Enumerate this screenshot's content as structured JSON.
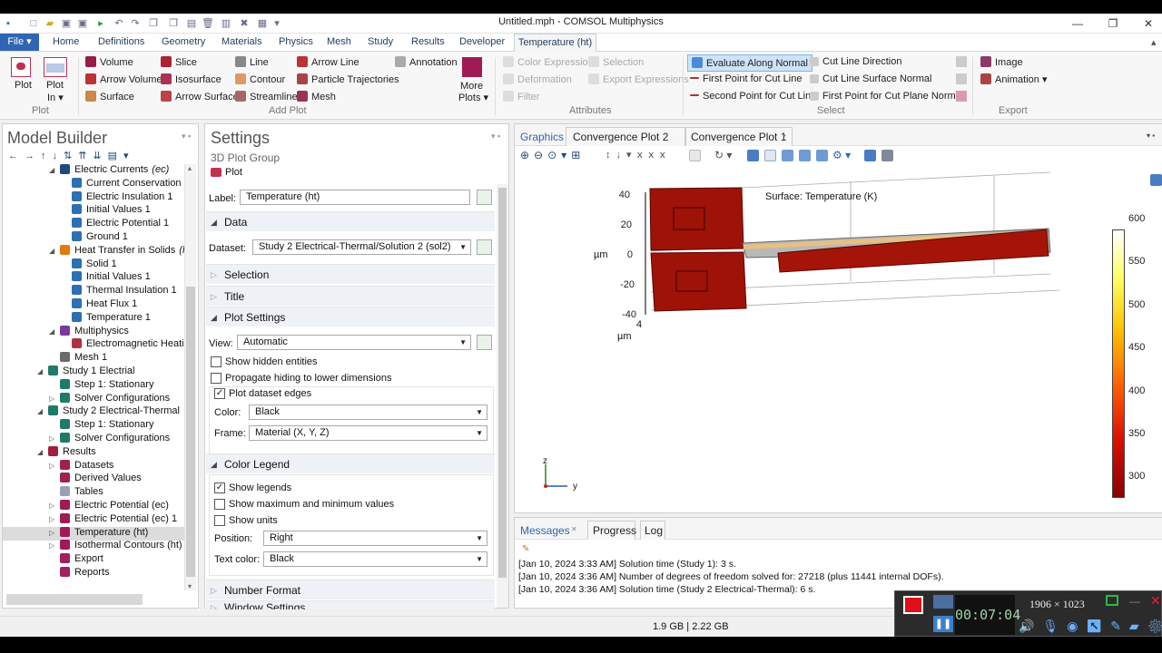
{
  "window": {
    "title": "Untitled.mph - COMSOL Multiphysics"
  },
  "menu_tabs": [
    "Home",
    "Definitions",
    "Geometry",
    "Materials",
    "Physics",
    "Mesh",
    "Study",
    "Results",
    "Developer"
  ],
  "file_label": "File ▾",
  "active_tab": "Temperature (ht)",
  "ribbon": {
    "plot": {
      "plot": "Plot",
      "plot_in": "Plot",
      "plot_in2": "In ▾",
      "group": "Plot"
    },
    "add_plot": {
      "items": [
        "Volume",
        "Arrow Volume",
        "Surface",
        "Slice",
        "Isosurface",
        "Arrow Surface",
        "Line",
        "Contour",
        "Streamline",
        "Arrow Line",
        "Particle Trajectories",
        "Mesh",
        "Annotation"
      ],
      "more": "More",
      "more2": "Plots ▾",
      "group": "Add Plot"
    },
    "attributes": {
      "items": [
        "Color Expression",
        "Selection",
        "Deformation",
        "Export Expressions",
        "Filter"
      ],
      "group": "Attributes"
    },
    "select": {
      "items": [
        "Evaluate Along Normal",
        "First Point for Cut Line",
        "Second Point for Cut Line",
        "Cut Line Direction",
        "Cut Line Surface Normal",
        "First Point for Cut Plane Normal"
      ],
      "group": "Select"
    },
    "export": {
      "items": [
        "Image",
        "Animation ▾"
      ],
      "group": "Export"
    }
  },
  "model_builder": {
    "title": "Model Builder",
    "tree": [
      {
        "label": "Electric Currents",
        "tag": "(ec)"
      },
      {
        "label": "Current Conservation 1"
      },
      {
        "label": "Electric Insulation 1"
      },
      {
        "label": "Initial Values 1"
      },
      {
        "label": "Electric Potential 1"
      },
      {
        "label": "Ground 1"
      },
      {
        "label": "Heat Transfer in Solids",
        "tag": "(ht)"
      },
      {
        "label": "Solid 1"
      },
      {
        "label": "Initial Values 1"
      },
      {
        "label": "Thermal Insulation 1"
      },
      {
        "label": "Heat Flux 1"
      },
      {
        "label": "Temperature 1"
      },
      {
        "label": "Multiphysics"
      },
      {
        "label": "Electromagnetic Heating"
      },
      {
        "label": "Mesh 1"
      },
      {
        "label": "Study 1 Electrial"
      },
      {
        "label": "Step 1: Stationary"
      },
      {
        "label": "Solver Configurations"
      },
      {
        "label": "Study 2 Electrical-Thermal"
      },
      {
        "label": "Step 1: Stationary"
      },
      {
        "label": "Solver Configurations"
      },
      {
        "label": "Results"
      },
      {
        "label": "Datasets"
      },
      {
        "label": "Derived Values"
      },
      {
        "label": "Tables"
      },
      {
        "label": "Electric Potential (ec)"
      },
      {
        "label": "Electric Potential (ec) 1"
      },
      {
        "label": "Temperature (ht)"
      },
      {
        "label": "Isothermal Contours (ht)"
      },
      {
        "label": "Export"
      },
      {
        "label": "Reports"
      }
    ]
  },
  "settings": {
    "title": "Settings",
    "subtitle": "3D Plot Group",
    "plot_btn": "Plot",
    "label_caption": "Label:",
    "label_value": "Temperature (ht)",
    "sections": {
      "data": "Data",
      "selection": "Selection",
      "title": "Title",
      "plot_settings": "Plot Settings",
      "color_legend": "Color Legend",
      "number_format": "Number Format",
      "window_settings": "Window Settings"
    },
    "dataset_caption": "Dataset:",
    "dataset_value": "Study 2 Electrical-Thermal/Solution 2 (sol2)",
    "view_caption": "View:",
    "view_value": "Automatic",
    "show_hidden": "Show hidden entities",
    "propagate": "Propagate hiding to lower dimensions",
    "dataset_edges": "Plot dataset edges",
    "color_caption": "Color:",
    "color_value": "Black",
    "frame_caption": "Frame:",
    "frame_value": "Material  (X, Y, Z)",
    "show_legends": "Show legends",
    "show_maxmin": "Show maximum and minimum values",
    "show_units": "Show units",
    "position_caption": "Position:",
    "position_value": "Right",
    "textcolor_caption": "Text color:",
    "textcolor_value": "Black"
  },
  "graphics": {
    "tabs": [
      "Graphics",
      "Convergence Plot 2",
      "Convergence Plot 1"
    ],
    "plot_title": "Surface: Temperature (K)",
    "y_ticks": [
      "40",
      "20",
      "0",
      "-20",
      "-40"
    ],
    "x_tick": "4",
    "y_unit": "µm",
    "x_unit": "µm",
    "colorbar": {
      "ticks": [
        "600",
        "550",
        "500",
        "450",
        "400",
        "350",
        "300"
      ],
      "min": 300,
      "max": 600
    },
    "axis_labels": {
      "z": "z",
      "y": "y"
    },
    "colors": {
      "device": "#9e1208",
      "colorbar_top": "#ffffff",
      "colorbar_bottom": "#8a0000"
    }
  },
  "messages": {
    "tabs": [
      "Messages",
      "Progress",
      "Log"
    ],
    "lines": [
      "[Jan 10, 2024 3:33 AM] Solution time (Study 1): 3 s.",
      "[Jan 10, 2024 3:36 AM] Number of degrees of freedom solved for: 27218 (plus 11441 internal DOFs).",
      "[Jan 10, 2024 3:36 AM] Solution time (Study 2 Electrical-Thermal): 6 s."
    ]
  },
  "status": {
    "memory": "1.9 GB | 2.22 GB"
  },
  "recorder": {
    "timer": "00:07:04",
    "resolution": "1906 × 1023"
  }
}
